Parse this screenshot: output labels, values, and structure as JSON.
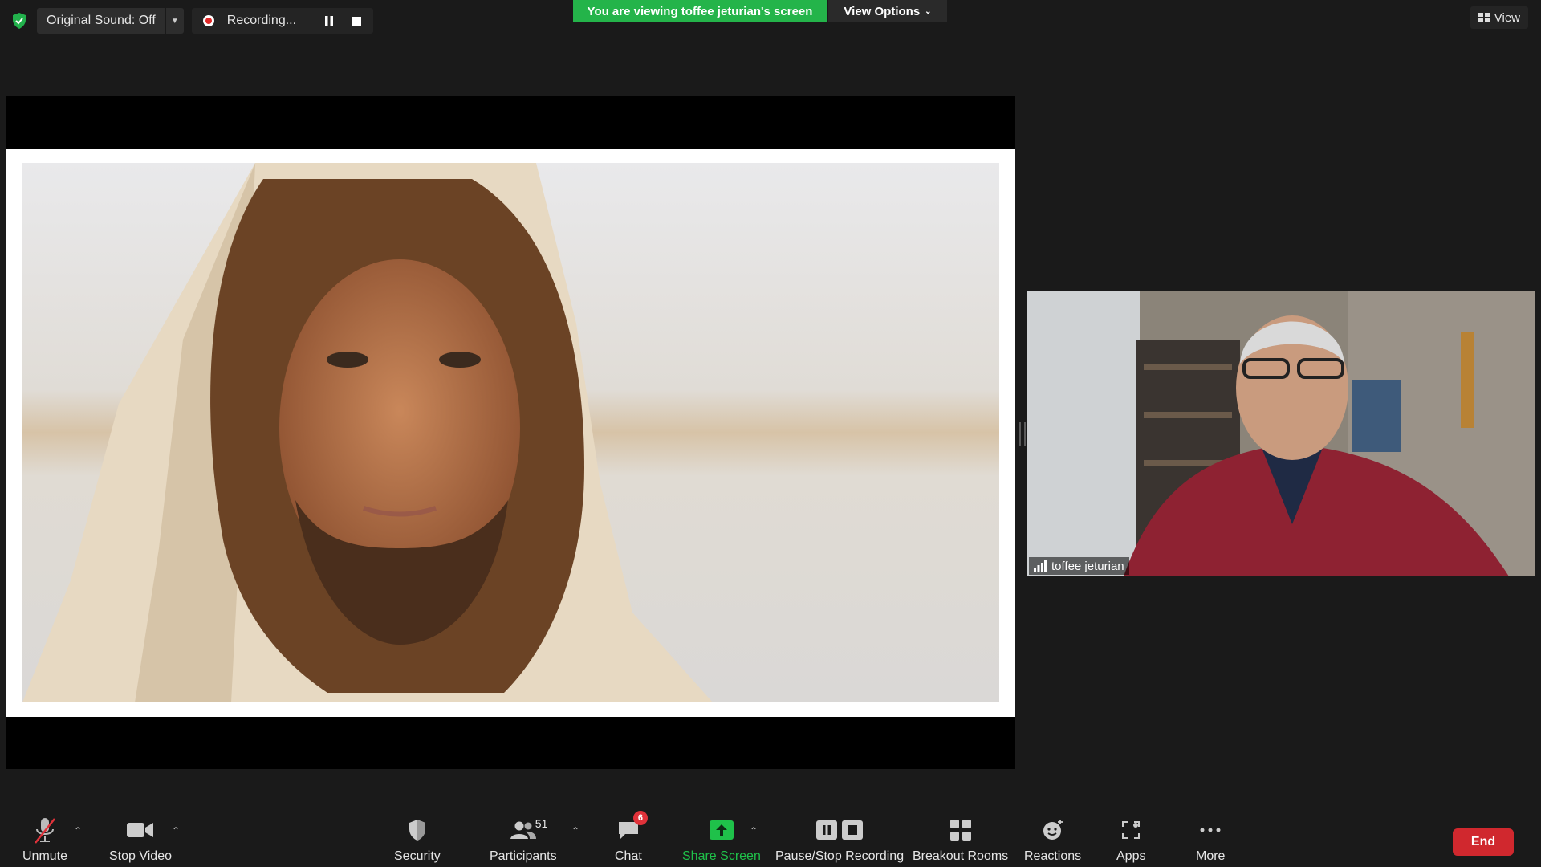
{
  "top": {
    "original_sound": "Original Sound: Off",
    "recording": "Recording...",
    "viewing_banner": "You are viewing toffee jeturian's screen",
    "view_options": "View Options",
    "view": "View"
  },
  "participant": {
    "name": "toffee jeturian"
  },
  "toolbar": {
    "unmute": "Unmute",
    "stop_video": "Stop Video",
    "security": "Security",
    "participants": "Participants",
    "participant_count": "51",
    "chat": "Chat",
    "chat_badge": "6",
    "share_screen": "Share Screen",
    "pause_stop_recording": "Pause/Stop Recording",
    "breakout_rooms": "Breakout Rooms",
    "reactions": "Reactions",
    "apps": "Apps",
    "more": "More",
    "end": "End"
  },
  "colors": {
    "banner_green": "#24b44a",
    "share_green": "#1fc14a",
    "end_red": "#d0282e",
    "badge_red": "#e0323a"
  }
}
